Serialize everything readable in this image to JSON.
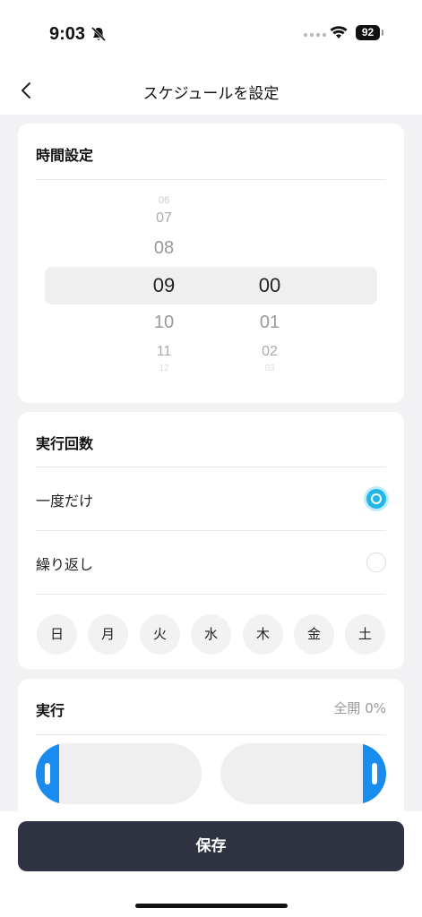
{
  "status_bar": {
    "time": "9:03",
    "battery": "92"
  },
  "nav": {
    "title": "スケジュールを設定"
  },
  "time_setting": {
    "heading": "時間設定",
    "hours": [
      "06",
      "07",
      "08",
      "09",
      "10",
      "11",
      "12"
    ],
    "minutes": [
      "00",
      "01",
      "02",
      "03"
    ],
    "selected_hour": "09",
    "selected_minute": "00"
  },
  "run_count": {
    "heading": "実行回数",
    "options": [
      {
        "label": "一度だけ",
        "selected": true
      },
      {
        "label": "繰り返し",
        "selected": false
      }
    ],
    "days": [
      "日",
      "月",
      "火",
      "水",
      "木",
      "金",
      "土"
    ]
  },
  "execute": {
    "heading": "実行",
    "status": "全開 0%"
  },
  "footer": {
    "save_label": "保存"
  },
  "colors": {
    "accent": "#1fb6e8",
    "handle": "#1a8cf0",
    "button": "#2f3240"
  }
}
